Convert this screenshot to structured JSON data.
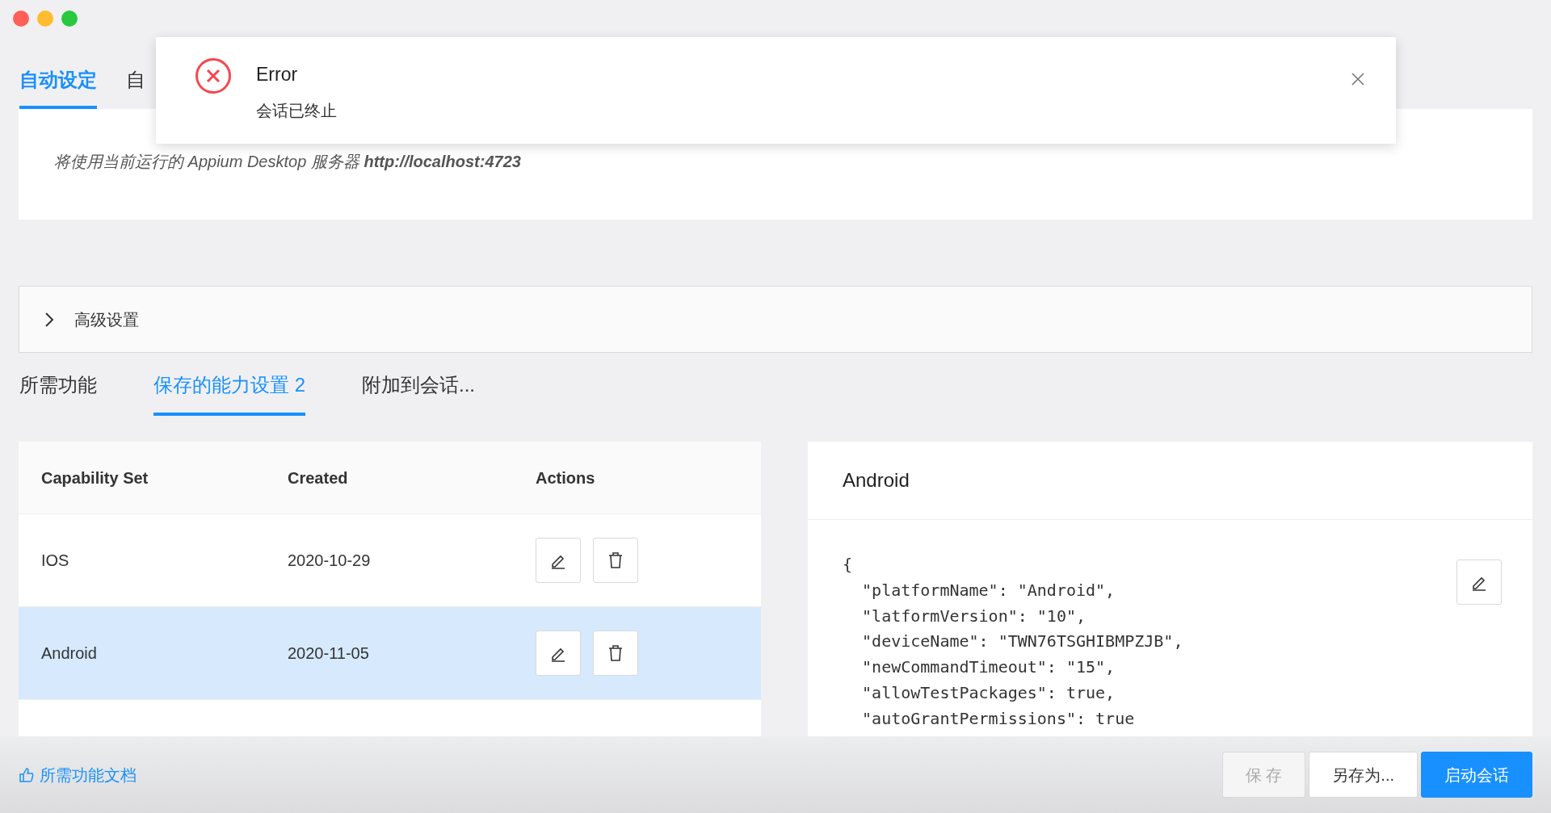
{
  "top_tabs": [
    {
      "label": "自动设定",
      "selected": true
    },
    {
      "label": "自",
      "selected": false
    }
  ],
  "notification": {
    "title": "Error",
    "message": "会话已终止"
  },
  "server_note": "将使用当前运行的 Appium Desktop 服务器 **http://localhost:4723**",
  "advanced": {
    "label": "高级设置",
    "expanded": false
  },
  "tabs": [
    {
      "label": "所需功能",
      "selected": false
    },
    {
      "label": "保存的能力设置 2",
      "selected": true
    },
    {
      "label": "附加到会话...",
      "selected": false
    }
  ],
  "table": {
    "columns": [
      "Capability Set",
      "Created",
      "Actions"
    ],
    "rows": [
      {
        "name": "IOS",
        "created": "2020-10-29",
        "selected": false
      },
      {
        "name": "Android",
        "created": "2020-11-05",
        "selected": true
      }
    ]
  },
  "detail": {
    "title": "Android",
    "json_lines": [
      "{",
      "  \"platformName\": \"Android\",",
      "  \"latformVersion\": \"10\",",
      "  \"deviceName\": \"TWN76TSGHIBMPZJB\",",
      "  \"newCommandTimeout\": \"15\",",
      "  \"allowTestPackages\": true,",
      "  \"autoGrantPermissions\": true"
    ]
  },
  "docs_link": "所需功能文档",
  "buttons": [
    {
      "label": "保 存",
      "kind": "default",
      "disabled": true
    },
    {
      "label": "另存为...",
      "kind": "default",
      "disabled": false
    },
    {
      "label": "启动会话",
      "kind": "primary",
      "disabled": false
    }
  ]
}
